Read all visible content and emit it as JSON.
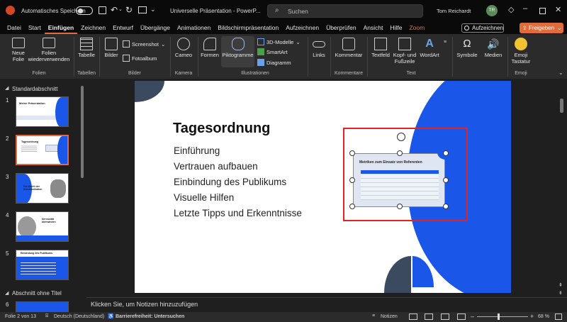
{
  "titlebar": {
    "autosave_label": "Automatisches Speichern",
    "doc_title": "Universelle Präsentation - PowerP...",
    "search_placeholder": "Suchen",
    "user_name": "Tom Reichardt",
    "user_initials": "TR"
  },
  "menu": {
    "tabs": [
      "Datei",
      "Start",
      "Einfügen",
      "Zeichnen",
      "Entwurf",
      "Übergänge",
      "Animationen",
      "Bildschirmpräsentation",
      "Aufzeichnen",
      "Überprüfen",
      "Ansicht",
      "Hilfe",
      "Zoom"
    ],
    "record_label": "Aufzeichnen",
    "share_label": "Freigeben"
  },
  "ribbon": {
    "new_slide": "Neue",
    "new_slide_2": "Folie",
    "reuse": "Folien",
    "reuse_2": "wiederverwenden",
    "table": "Tabelle",
    "images": "Bilder",
    "screenshot": "Screenshot",
    "photoalbum": "Fotoalbum",
    "cameo": "Cameo",
    "shapes": "Formen",
    "pictograms": "Piktogramme",
    "models3d": "3D-Modelle",
    "smartart": "SmartArt",
    "diagram": "Diagramm",
    "links": "Links",
    "comment": "Kommentar",
    "textfield": "Textfeld",
    "headerfooter": "Kopf- und",
    "headerfooter_2": "Fußzeile",
    "wordart": "WordArt",
    "symbols": "Symbole",
    "media": "Medien",
    "emoji": "Emoji",
    "emoji_2": "Tastatur",
    "groups": {
      "slides": "Folien",
      "tables": "Tabellen",
      "images": "Bilder",
      "camera": "Kamera",
      "illustrations": "Illustrationen",
      "comments": "Kommentare",
      "text": "Text",
      "emoji": "Emoji"
    }
  },
  "slides_panel": {
    "section1": "Standardabschnitt",
    "section2": "Abschnitt ohne Titel",
    "numbers": [
      "1",
      "2",
      "3",
      "4",
      "5",
      "6"
    ],
    "thumb1_title": "Meine Präsentation",
    "thumb2_title": "Tagesordnung",
    "thumb3_title": "Die Macht der Kommunikation",
    "thumb4_title": "Nervosität überwinden",
    "thumb5_title": "Einbindung des Publikums"
  },
  "slide": {
    "title": "Tagesordnung",
    "bullets": [
      "Einführung",
      "Vertrauen aufbauen",
      "Einbindung des Publikums",
      "Visuelle Hilfen",
      "Letzte Tipps und Erkenntnisse"
    ],
    "embedded_title": "Metriken zum Einsatz von Referenten"
  },
  "notes_placeholder": "Klicken Sie, um Notizen hinzuzufügen",
  "status": {
    "slide_of": "Folie 2 von 13",
    "language": "Deutsch (Deutschland)",
    "accessibility": "Barrierefreiheit: Untersuchen",
    "notes": "Notizen",
    "zoom": "68 %"
  },
  "colors": {
    "accent_orange": "#e06c3c",
    "slide_blue": "#1a56e8",
    "slide_dark": "#3b4a5e",
    "selection_red": "#e02424"
  }
}
